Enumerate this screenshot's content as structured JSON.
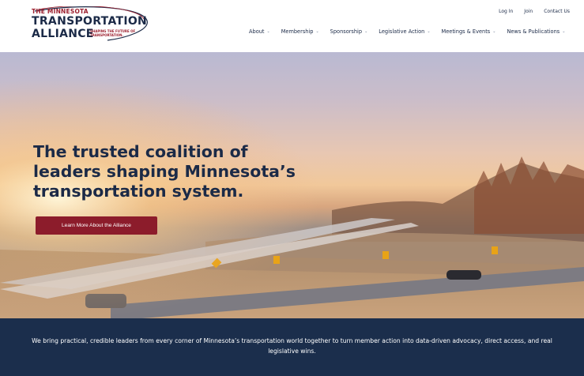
{
  "brand": {
    "line1": "THE MINNESOTA",
    "line2": "TRANSPORTATION",
    "line3": "ALLIANCE",
    "tagline": "SHAPING THE FUTURE OF TRANSPORTATION."
  },
  "utility_nav": [
    "Log In",
    "Join",
    "Contact Us"
  ],
  "main_nav": [
    {
      "label": "About"
    },
    {
      "label": "Membership"
    },
    {
      "label": "Sponsorship"
    },
    {
      "label": "Legislative Action"
    },
    {
      "label": "Meetings & Events"
    },
    {
      "label": "News & Publications"
    }
  ],
  "hero": {
    "title_lines": [
      "The trusted coalition of",
      "leaders shaping Minnesota’s",
      "transportation system."
    ],
    "cta_label": "Learn More About the Alliance"
  },
  "mission": {
    "text": "We bring practical, credible leaders from every corner of Minnesota’s transportation world together to turn member action into data-driven advocacy, direct access, and real legislative wins."
  },
  "colors": {
    "navy": "#1b2a47",
    "accent_red": "#8c1c2b",
    "band": "#1b2e4c"
  }
}
